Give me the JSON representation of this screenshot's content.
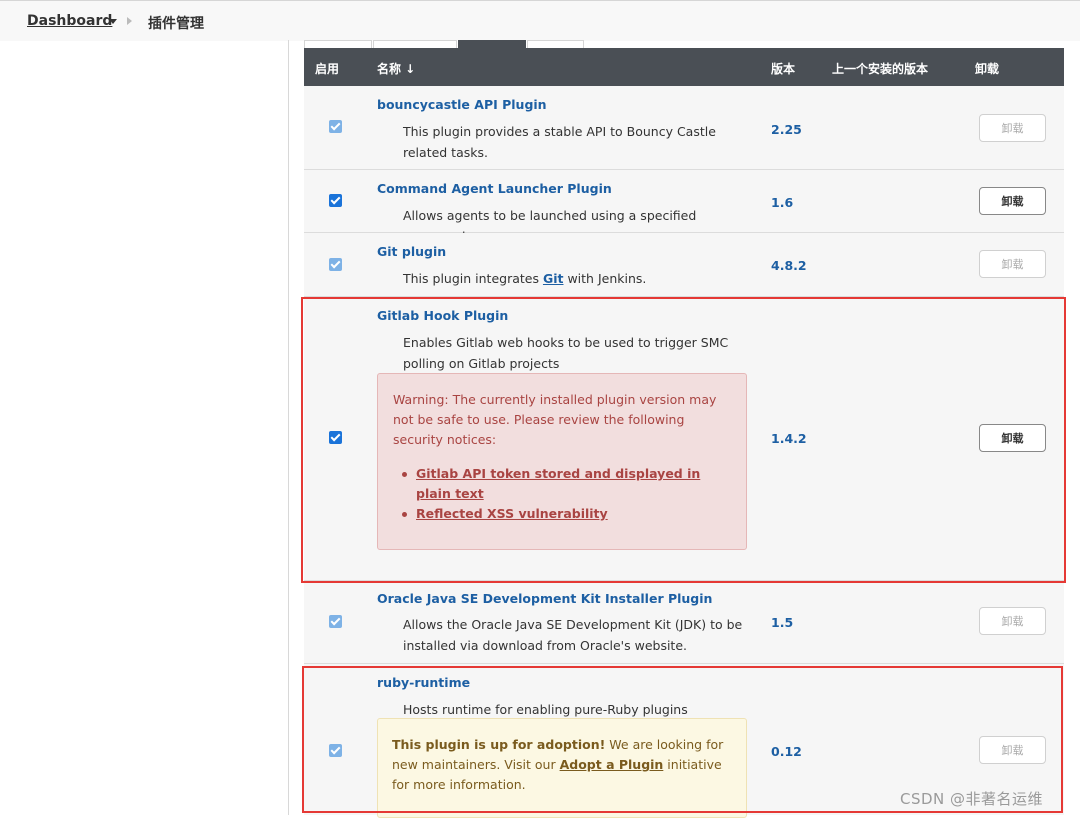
{
  "breadcrumb": {
    "dashboard": "Dashboard",
    "current": "插件管理"
  },
  "table": {
    "headers": {
      "enabled": "启用",
      "name": "名称 ↓",
      "version": "版本",
      "previous_version": "上一个安装的版本",
      "uninstall": "卸载"
    }
  },
  "plugins": [
    {
      "name": "bouncycastle API Plugin",
      "description": "This plugin provides a stable API to Bouncy Castle related tasks.",
      "version": "2.25",
      "enabled": true,
      "uninstall_label": "卸载",
      "uninstall_enabled": false
    },
    {
      "name": "Command Agent Launcher Plugin",
      "description": "Allows agents to be launched using a specified command.",
      "version": "1.6",
      "enabled": true,
      "uninstall_label": "卸载",
      "uninstall_enabled": true
    },
    {
      "name": "Git plugin",
      "description_before": "This plugin integrates ",
      "description_link": "Git",
      "description_after": " with Jenkins.",
      "version": "4.8.2",
      "enabled": true,
      "uninstall_label": "卸载",
      "uninstall_enabled": false
    },
    {
      "name": "Gitlab Hook Plugin",
      "description": "Enables Gitlab web hooks to be used to trigger SMC polling on Gitlab projects",
      "warning": "Warning: The currently installed plugin version may not be safe to use. Please review the following security notices:",
      "security_notices": [
        "Gitlab API token stored and displayed in plain text",
        "Reflected XSS vulnerability"
      ],
      "version": "1.4.2",
      "enabled": true,
      "uninstall_label": "卸载",
      "uninstall_enabled": true
    },
    {
      "name": "Oracle Java SE Development Kit Installer Plugin",
      "description": "Allows the Oracle Java SE Development Kit (JDK) to be installed via download from Oracle's website.",
      "version": "1.5",
      "enabled": true,
      "uninstall_label": "卸载",
      "uninstall_enabled": false
    },
    {
      "name": "ruby-runtime",
      "description": "Hosts runtime for enabling pure-Ruby plugins",
      "adoption_bold": "This plugin is up for adoption!",
      "adoption_text_1": " We are looking for new maintainers. Visit our ",
      "adoption_link": "Adopt a Plugin",
      "adoption_text_2": " initiative for more information.",
      "version": "0.12",
      "enabled": true,
      "uninstall_label": "卸载",
      "uninstall_enabled": false
    }
  ],
  "watermark": "CSDN @非著名运维",
  "colors": {
    "header_bg": "#4a4f55",
    "link": "#1d5fa3",
    "warning_bg": "#f2dede",
    "warning_text": "#a94442",
    "adoption_bg": "#fcf8e3",
    "highlight_border": "#e53935",
    "checkbox": "#1a73d9"
  }
}
